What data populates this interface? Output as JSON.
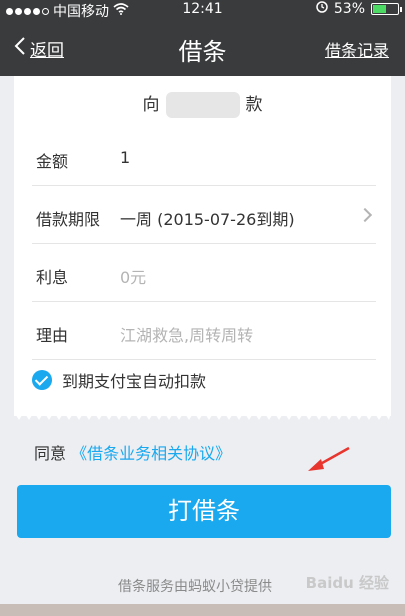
{
  "status": {
    "carrier": "中国移动",
    "time": "12:41",
    "battery": "53%",
    "battery_level": 0.53
  },
  "nav": {
    "back_label": "返回",
    "title": "借条",
    "right_link": "借条记录"
  },
  "form": {
    "to_prefix": "向",
    "to_suffix": "款",
    "rows": [
      {
        "label": "金额",
        "value": "1",
        "placeholder": false
      },
      {
        "label": "借款期限",
        "value": "一周 (2015-07-26到期)",
        "placeholder": false
      },
      {
        "label": "利息",
        "value": "0元",
        "placeholder": true
      },
      {
        "label": "理由",
        "value": "江湖救急,周转周转",
        "placeholder": true
      }
    ],
    "auto_debit_label": "到期支付宝自动扣款"
  },
  "agreement": {
    "prefix": "同意",
    "link": "《借条业务相关协议》"
  },
  "button": {
    "label": "打借条"
  },
  "footer": {
    "text": "借条服务由蚂蚁小贷提供",
    "watermark": "Baidu 经验"
  },
  "colors": {
    "nav_bg": "#3a3b3d",
    "accent": "#1aa8ee",
    "page_bg": "#eceef2"
  }
}
